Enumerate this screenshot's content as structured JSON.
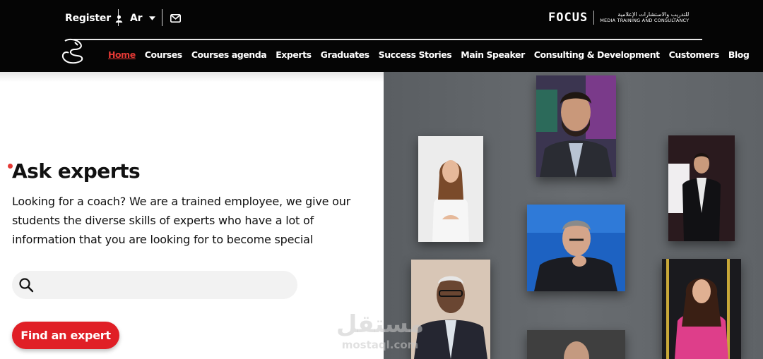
{
  "topbar": {
    "register_label": "Register",
    "language_label": "Ar"
  },
  "brand": {
    "name": "FOCUS",
    "subtitle_ar": "للتدريب والاستشارات الإعلامية",
    "subtitle_en": "MEDIA TRAINING AND CONSULTANCY"
  },
  "nav": {
    "items": [
      {
        "label": "Home",
        "active": true
      },
      {
        "label": "Courses"
      },
      {
        "label": "Courses agenda"
      },
      {
        "label": "Experts"
      },
      {
        "label": "Graduates"
      },
      {
        "label": "Success Stories"
      },
      {
        "label": "Main Speaker"
      },
      {
        "label": "Consulting & Development"
      },
      {
        "label": "Customers"
      },
      {
        "label": "Blog"
      }
    ]
  },
  "hero": {
    "title": "Ask experts",
    "description": "Looking for a coach? We are a trained employee, we give our students the diverse skills of experts who have a lot of information that you are looking for to become special",
    "search_placeholder": "",
    "button_label": "Find an expert"
  },
  "watermark": {
    "arabic": "مستقل",
    "latin": "mostaql.com"
  },
  "colors": {
    "accent": "#e01f26",
    "header_bg": "#050505",
    "gallery_bg": "#62666a"
  }
}
